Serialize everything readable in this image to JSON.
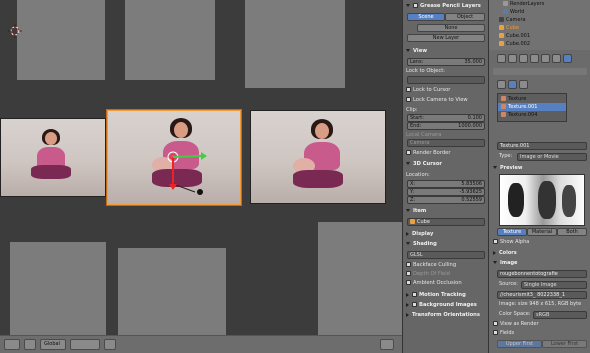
{
  "npanel": {
    "gpencil": {
      "title": "Grease Pencil Layers",
      "scene": "Scene",
      "object": "Object",
      "none": "None",
      "new_layer": "New Layer"
    },
    "view": {
      "title": "View",
      "lens_label": "Lens:",
      "lens_value": "35.000",
      "lock_to_object": "Lock to Object:",
      "lock_cursor": "Lock to Cursor",
      "lock_camera": "Lock Camera to View",
      "clip": "Clip:",
      "start_label": "Start:",
      "start_value": "0.100",
      "end_label": "End:",
      "end_value": "1000.000",
      "local_camera": "Local Camera",
      "camera": "Camera",
      "render_border": "Render Border"
    },
    "cursor": {
      "title": "3D Cursor",
      "location": "Location:",
      "x_label": "X:",
      "x": "5.83506",
      "y_label": "Y:",
      "y": "-5.93625",
      "z_label": "Z:",
      "z": "0.52559"
    },
    "item": {
      "title": "Item",
      "name": "Cube"
    },
    "display": "Display",
    "shading": {
      "title": "Shading",
      "mode": "GLSL",
      "backface": "Backface Culling",
      "depth": "Depth Of Field",
      "ao": "Ambient Occlusion"
    },
    "motion": "Motion Tracking",
    "bg_images": "Background Images",
    "transform_orient": "Transform Orientations"
  },
  "outliner": {
    "items": [
      "RenderLayers",
      "World",
      "Camera",
      "Cube",
      "Cube.001",
      "Cube.002"
    ]
  },
  "props": {
    "textures": [
      "Texture",
      "Texture.001",
      "Texture.004"
    ],
    "tex_name": "Texture.001",
    "type_label": "Type:",
    "type_value": "Image or Movie",
    "preview": "Preview",
    "tabs": [
      "Texture",
      "Material",
      "Both"
    ],
    "show_alpha": "Show Alpha",
    "colors": "Colors",
    "image": "Image",
    "image_name": "rougebonnentotografie",
    "source_label": "Source:",
    "source_value": "Single Image",
    "path": "//cheurismit3_ 8022338_1",
    "image_info": "Image: size 948 x 615, RGB byte",
    "colorspace_label": "Color Space:",
    "colorspace_value": "sRGB",
    "view_as_render": "View as Render",
    "fields": "Fields",
    "upper": "Upper First",
    "lower": "Lower First"
  },
  "vbar": {
    "orientation": "Global"
  }
}
